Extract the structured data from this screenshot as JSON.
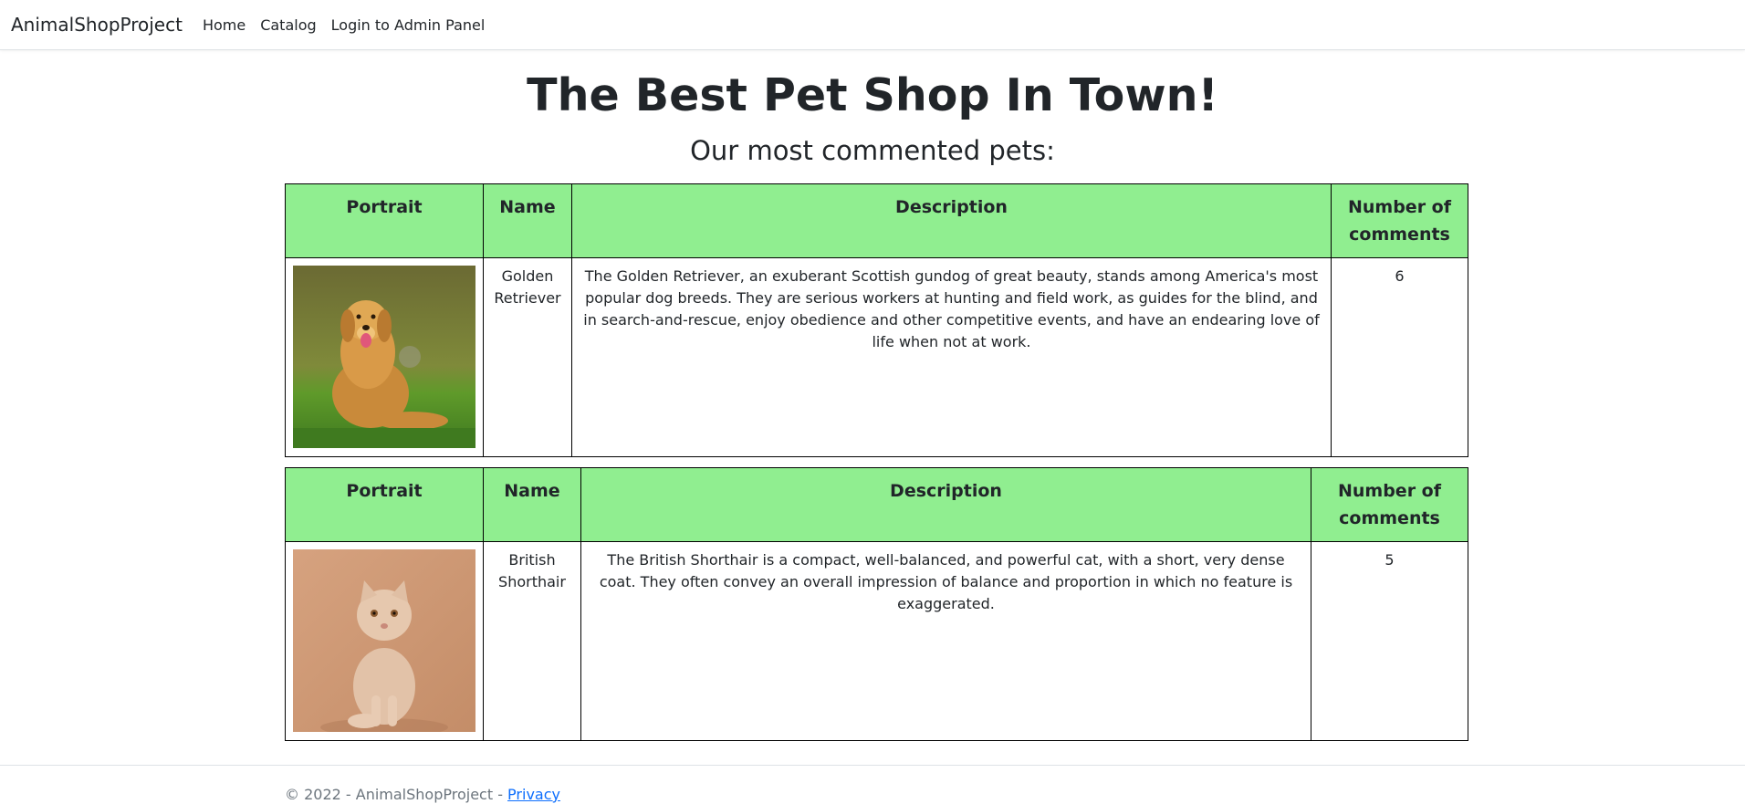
{
  "nav": {
    "brand": "AnimalShopProject",
    "links": [
      "Home",
      "Catalog",
      "Login to Admin Panel"
    ]
  },
  "header": {
    "title": "The Best Pet Shop In Town!",
    "subtitle": "Our most commented pets:"
  },
  "table_headers": [
    "Portrait",
    "Name",
    "Description",
    "Number of comments"
  ],
  "pets": [
    {
      "name": "Golden Retriever",
      "description": "The Golden Retriever, an exuberant Scottish gundog of great beauty, stands among America's most popular dog breeds. They are serious workers at hunting and field work, as guides for the blind, and in search-and-rescue, enjoy obedience and other competitive events, and have an endearing love of life when not at work.",
      "comments": "6",
      "portrait_icon": "golden-retriever-photo"
    },
    {
      "name": "British Shorthair",
      "description": "The British Shorthair is a compact, well-balanced, and powerful cat, with a short, very dense coat. They often convey an overall impression of balance and proportion in which no feature is exaggerated.",
      "comments": "5",
      "portrait_icon": "british-shorthair-photo"
    }
  ],
  "footer": {
    "text": "© 2022 - AnimalShopProject - ",
    "privacy_link": "Privacy"
  },
  "colors": {
    "header_bg": "#90ee90",
    "link": "#0d6efd",
    "footer_text": "#6c757d"
  }
}
